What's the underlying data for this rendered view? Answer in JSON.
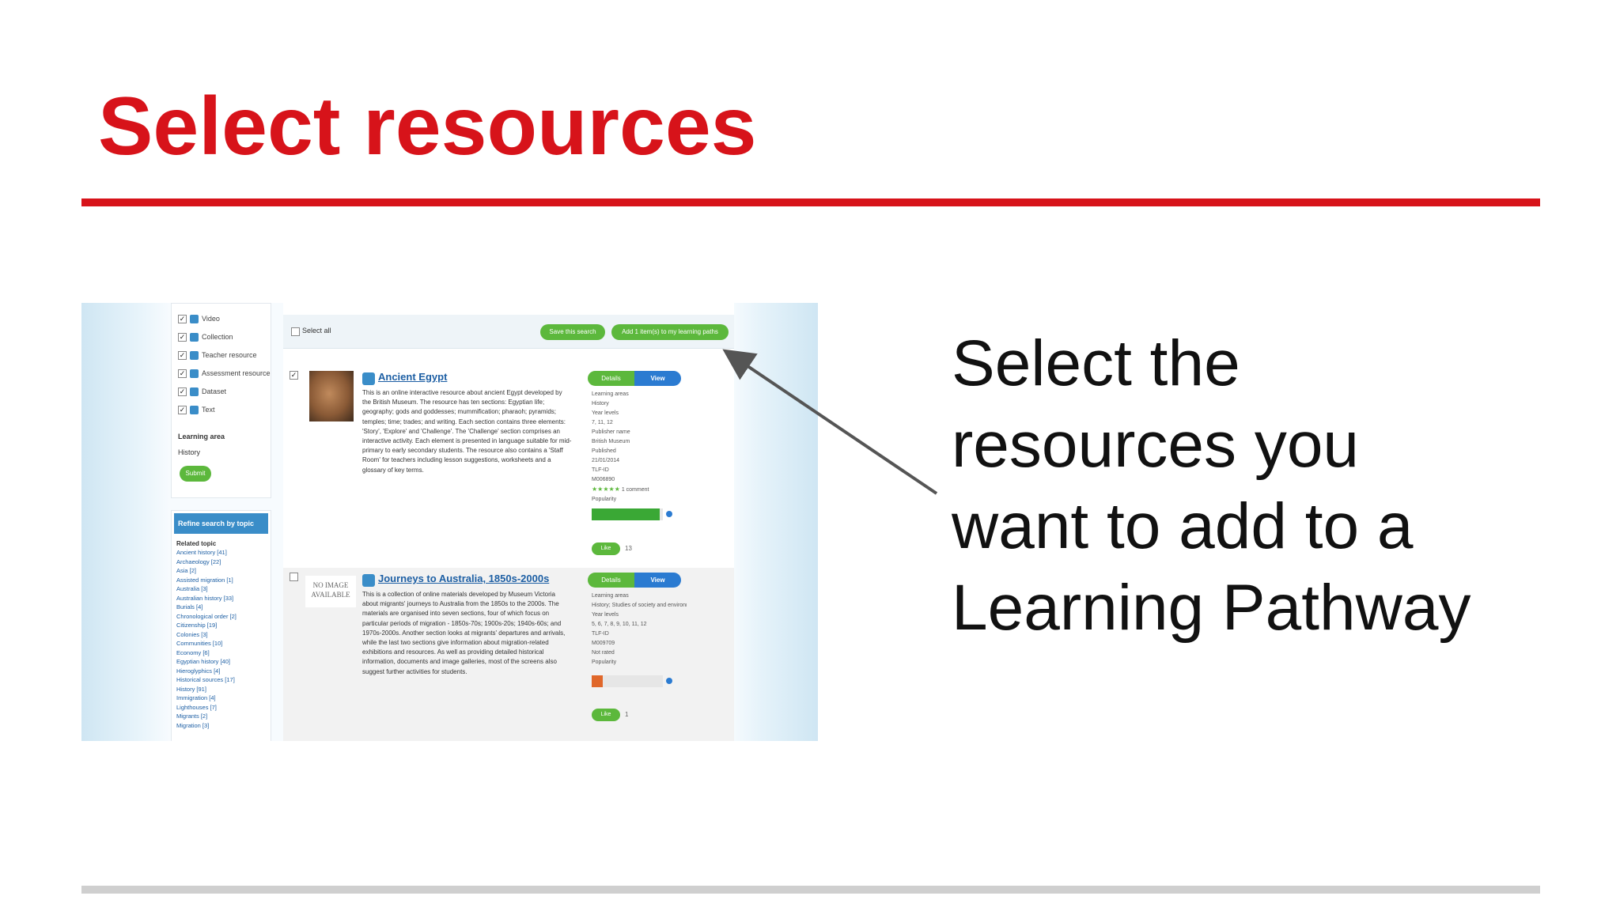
{
  "slide": {
    "title": "Select resources",
    "callout_lines": [
      "Select the",
      "resources you",
      "want to add to a",
      "Learning Pathway"
    ],
    "accent_color": "#d7131a"
  },
  "screenshot": {
    "filters": [
      {
        "label": "Video",
        "checked": true
      },
      {
        "label": "Collection",
        "checked": true
      },
      {
        "label": "Teacher resource",
        "checked": true
      },
      {
        "label": "Assessment resource",
        "checked": true
      },
      {
        "label": "Dataset",
        "checked": true
      },
      {
        "label": "Text",
        "checked": true
      }
    ],
    "learning_area_label": "Learning area",
    "learning_area_value": "History",
    "submit_label": "Submit",
    "refine_heading": "Refine search by topic",
    "related_topic_label": "Related topic",
    "topics": [
      "Ancient history [41]",
      "Archaeology [22]",
      "Asia [2]",
      "Assisted migration [1]",
      "Australia [3]",
      "Australian history [33]",
      "Burials [4]",
      "Chronological order [2]",
      "Citizenship [19]",
      "Colonies [3]",
      "Communities [10]",
      "Economy [6]",
      "Egyptian history [40]",
      "Hieroglyphics [4]",
      "Historical sources [17]",
      "History [91]",
      "Immigration [4]",
      "Lighthouses [7]",
      "Migrants [2]",
      "Migration [3]"
    ],
    "toolbar": {
      "select_all": "Select all",
      "save_search": "Save this search",
      "add_to_path": "Add 1 item(s) to my learning paths"
    },
    "items": [
      {
        "title": "Ancient Egypt",
        "checked": true,
        "description": "This is an online interactive resource about ancient Egypt developed by the British Museum. The resource has ten sections: Egyptian life; geography; gods and goddesses; mummification; pharaoh; pyramids; temples; time; trades; and writing. Each section contains three elements: 'Story', 'Explore' and 'Challenge'. The 'Challenge' section comprises an interactive activity. Each element is presented in language suitable for mid-primary to early secondary students. The resource also contains a 'Staff Room' for teachers including lesson suggestions, worksheets and a glossary of key terms.",
        "details_label": "Details",
        "view_label": "View",
        "meta": [
          "Learning areas",
          "History",
          "Year levels",
          "7, 11, 12",
          "Publisher name",
          "British Museum",
          "Published",
          "21/01/2014",
          "TLF-ID",
          "M006890"
        ],
        "stars": "★★★★★",
        "comments": "1 comment",
        "popularity_label": "Popularity",
        "popularity": 0.95,
        "popularity_color": "#3aa835",
        "like_label": "Like",
        "like_count": "13"
      },
      {
        "title": "Journeys to Australia, 1850s-2000s",
        "checked": false,
        "no_image": "NO IMAGE AVAILABLE",
        "description": "This is a collection of online materials developed by Museum Victoria about migrants' journeys to Australia from the 1850s to the 2000s. The materials are organised into seven sections, four of which focus on particular periods of migration - 1850s-70s; 1900s-20s; 1940s-60s; and 1970s-2000s. Another section looks at migrants' departures and arrivals, while the last two sections give information about migration-related exhibitions and resources. As well as providing detailed historical information, documents and image galleries, most of the screens also suggest further activities for students.",
        "details_label": "Details",
        "view_label": "View",
        "meta": [
          "Learning areas",
          "History; Studies of society and environment",
          "Year levels",
          "5, 6, 7, 8, 9, 10, 11, 12",
          "TLF-ID",
          "M009709",
          "Not rated",
          "Popularity"
        ],
        "popularity": 0.16,
        "popularity_color": "#e0672a",
        "like_label": "Like",
        "like_count": "1"
      }
    ]
  }
}
